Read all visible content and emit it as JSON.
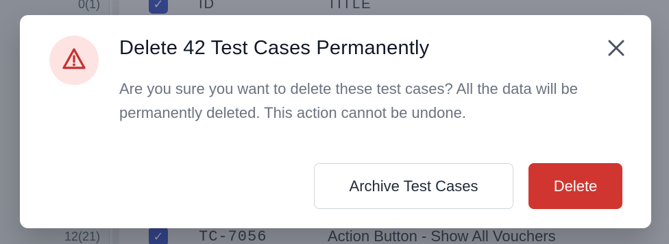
{
  "background": {
    "row_top": {
      "number": "0(1)",
      "id": "ID",
      "title": "TITLE"
    },
    "row_bottom": {
      "number": "12(21)",
      "id": "TC-7056",
      "title": "Action Button - Show All Vouchers"
    },
    "check_glyph": "✓"
  },
  "dialog": {
    "title": "Delete 42 Test Cases Permanently",
    "description": "Are you sure you want to delete these test cases? All the data will be permanently deleted. This action cannot be undone.",
    "archive_label": "Archive Test Cases",
    "delete_label": "Delete",
    "icon": "warning-triangle-icon"
  },
  "colors": {
    "danger": "#d0362f",
    "danger_soft": "#fde3e1",
    "checkbox": "#4f68d6"
  }
}
